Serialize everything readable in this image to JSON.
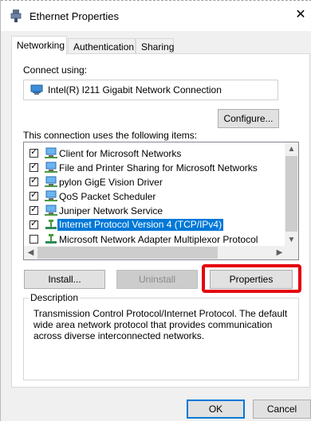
{
  "window": {
    "title": "Ethernet Properties",
    "close_glyph": "✕"
  },
  "tabs": [
    {
      "label": "Networking",
      "active": true
    },
    {
      "label": "Authentication",
      "active": false
    },
    {
      "label": "Sharing",
      "active": false
    }
  ],
  "connect_using": {
    "label": "Connect using:",
    "adapter": "Intel(R) I211 Gigabit Network Connection",
    "configure_button": "Configure..."
  },
  "items_section": {
    "label": "This connection uses the following items:",
    "items": [
      {
        "label": "Client for Microsoft Networks",
        "checked": true,
        "icon": "network-client-icon"
      },
      {
        "label": "File and Printer Sharing for Microsoft Networks",
        "checked": true,
        "icon": "network-service-icon"
      },
      {
        "label": "pylon GigE Vision Driver",
        "checked": true,
        "icon": "driver-icon"
      },
      {
        "label": "QoS Packet Scheduler",
        "checked": true,
        "icon": "network-service-icon"
      },
      {
        "label": "Juniper Network Service",
        "checked": true,
        "icon": "network-service-icon"
      },
      {
        "label": "Internet Protocol Version 4 (TCP/IPv4)",
        "checked": true,
        "selected": true,
        "icon": "protocol-icon"
      },
      {
        "label": "Microsoft Network Adapter Multiplexor Protocol",
        "checked": false,
        "icon": "protocol-icon"
      }
    ]
  },
  "buttons": {
    "install": "Install...",
    "uninstall": "Uninstall",
    "properties": "Properties",
    "ok": "OK",
    "cancel": "Cancel"
  },
  "description": {
    "legend": "Description",
    "text": "Transmission Control Protocol/Internet Protocol. The default wide area network protocol that provides communication across diverse interconnected networks."
  },
  "colors": {
    "selection": "#0078d7",
    "highlight_box": "#e4040c"
  }
}
